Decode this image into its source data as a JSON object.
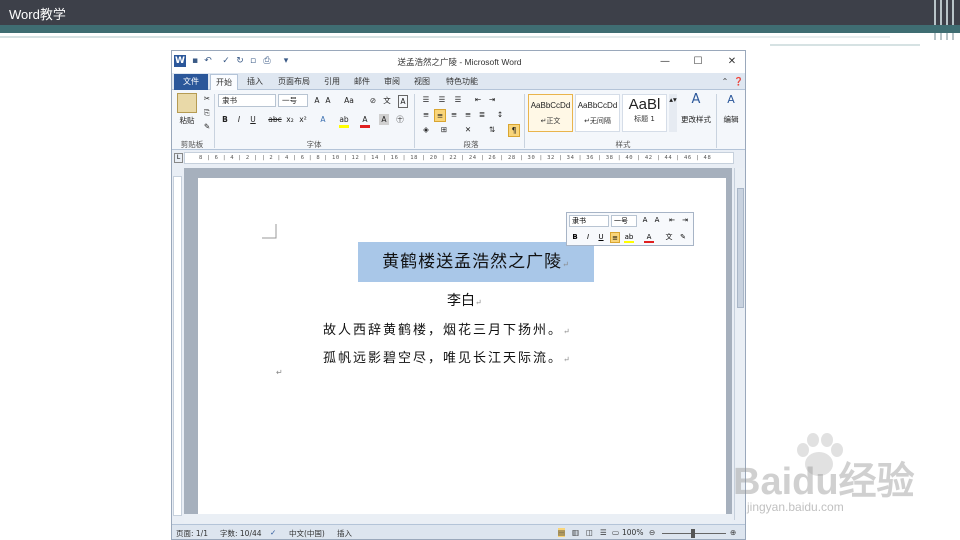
{
  "slide": {
    "title": "Word教学"
  },
  "window": {
    "title": "送孟浩然之广陵 - Microsoft Word",
    "controls": {
      "minimize": "—",
      "maximize": "☐",
      "close": "✕"
    }
  },
  "tabs": [
    "文件",
    "开始",
    "插入",
    "页面布局",
    "引用",
    "邮件",
    "审阅",
    "视图",
    "特色功能"
  ],
  "ribbon": {
    "clipboard": {
      "paste_label": "粘贴",
      "group_label": "剪贴板"
    },
    "font": {
      "font_name": "隶书",
      "font_size": "一号",
      "group_label": "字体",
      "buttons": [
        "B",
        "I",
        "U",
        "abc",
        "x₂",
        "x²"
      ]
    },
    "paragraph": {
      "group_label": "段落"
    },
    "styles": {
      "group_label": "样式",
      "cards": [
        {
          "sample": "AaBbCcDd",
          "name": "↵正文"
        },
        {
          "sample": "AaBbCcDd",
          "name": "↵无间隔"
        },
        {
          "sample": "AaBl",
          "name": "标题 1"
        }
      ],
      "change_styles": "更改样式"
    },
    "editing": {
      "label": "编辑"
    }
  },
  "ruler": {
    "ticks": "8 | 6 | 4 | 2 | | 2 | 4 | 6 | 8 | 10 | 12 | 14 | 16 | 18 | 20 | 22 | 24 | 26 | 28 | 30 | 32 | 34 | 36 | 38 | 40 | 42 | 44 | 46 | 48"
  },
  "document": {
    "title": "黄鹤楼送孟浩然之广陵",
    "author": "李白",
    "line1": "故人西辞黄鹤楼，烟花三月下扬州。",
    "line2": "孤帆远影碧空尽，唯见长江天际流。",
    "para_mark": "↵"
  },
  "mini_toolbar": {
    "font_name": "隶书",
    "font_size": "一号",
    "bold": "B",
    "italic": "I",
    "underline": "U"
  },
  "status": {
    "page": "页面: 1/1",
    "words": "字数: 10/44",
    "language": "中文(中国)",
    "mode": "插入",
    "zoom": "100%"
  },
  "watermark": {
    "brand": "Baidu经验",
    "url": "jingyan.baidu.com"
  },
  "colors": {
    "file_tab": "#2b579a",
    "header_bg": "#3d4049",
    "accent_band": "#3f6d72",
    "selection": "#a9c7e8"
  }
}
